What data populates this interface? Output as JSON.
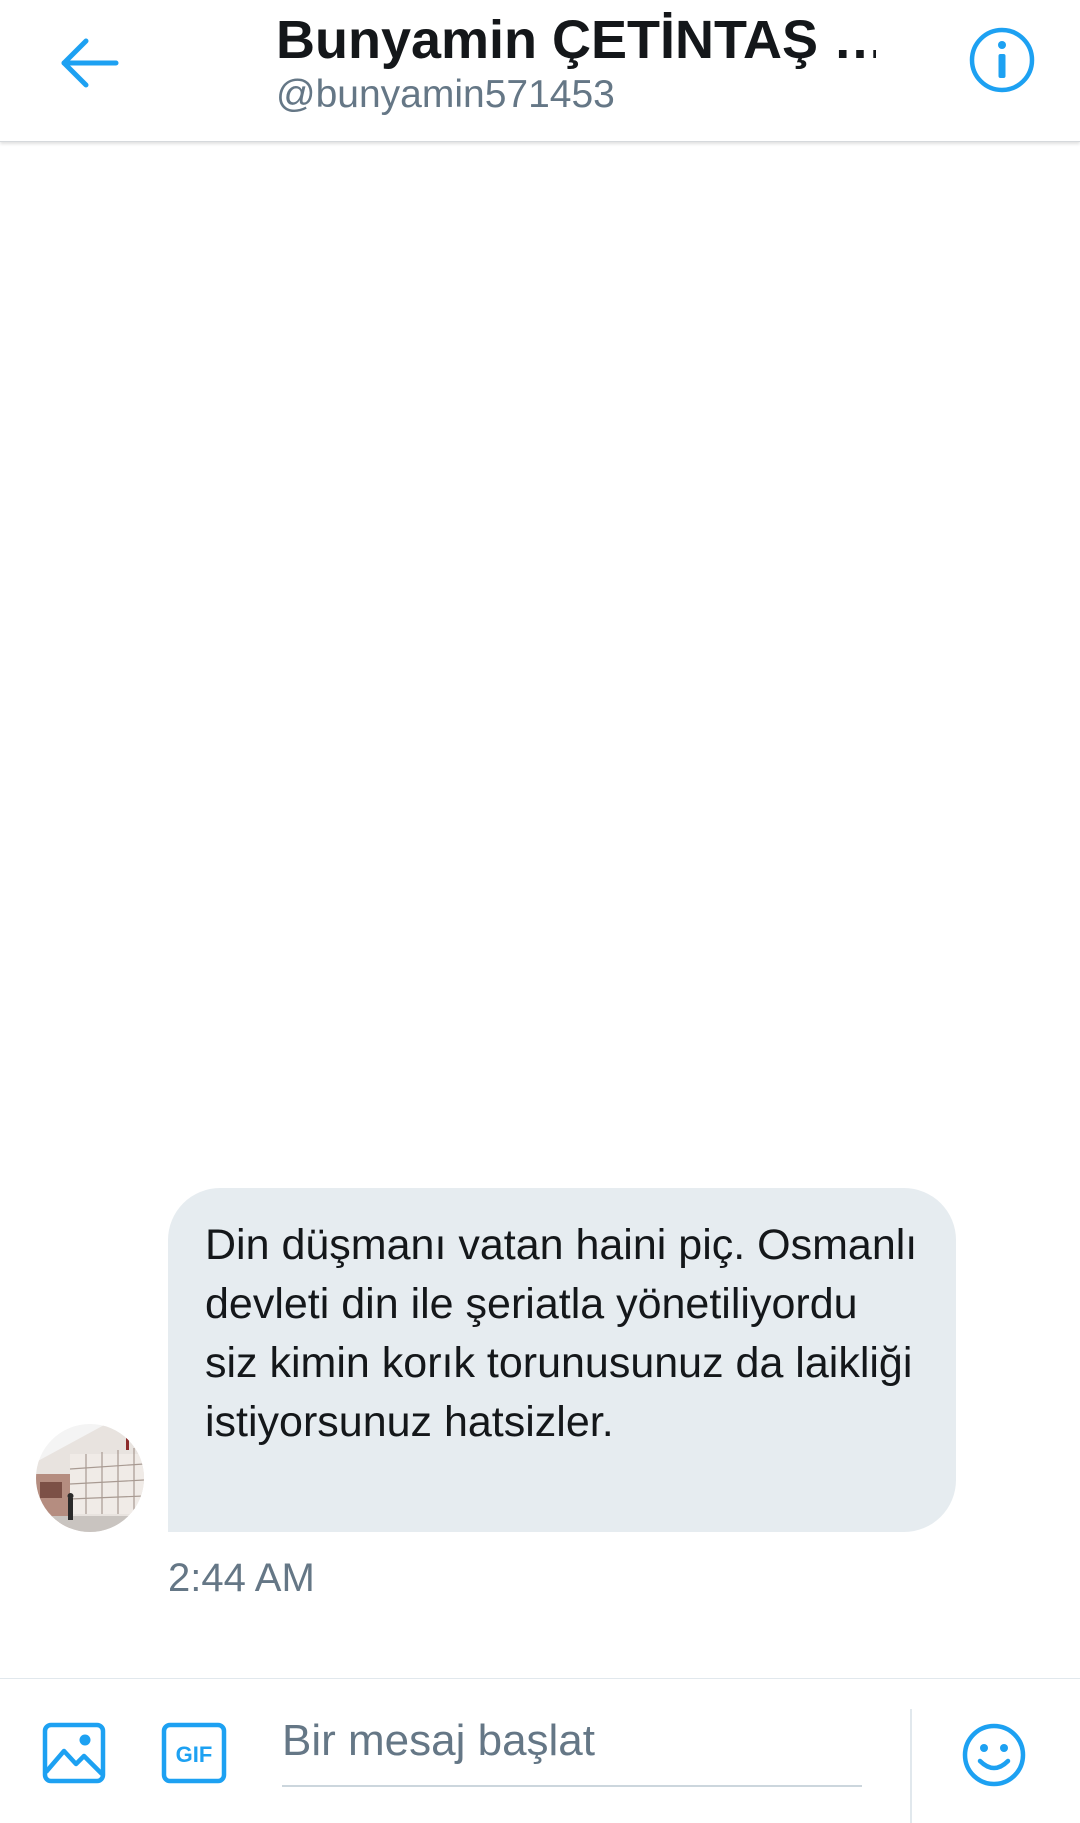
{
  "header": {
    "title": "Bunyamin ÇETİNTAŞ …",
    "handle": "@bunyamin571453"
  },
  "conversation": {
    "messages": [
      {
        "text": "Din düşmanı vatan haini piç. Osmanlı devleti din ile şeriatla yönetiliyordu siz kimin korık torunusunuz da laikliği istiyorsunuz hatsizler.",
        "time": "2:44 AM",
        "direction": "incoming"
      }
    ]
  },
  "composer": {
    "placeholder": "Bir mesaj başlat",
    "value": ""
  },
  "icons": {
    "back": "arrow-left-icon",
    "info": "info-icon",
    "image": "image-icon",
    "gif": "gif-icon",
    "emoji": "emoji-icon"
  },
  "colors": {
    "accent": "#1da1f2",
    "bubble": "#e6ecf0",
    "text": "#14171a",
    "secondary_text": "#657786"
  }
}
